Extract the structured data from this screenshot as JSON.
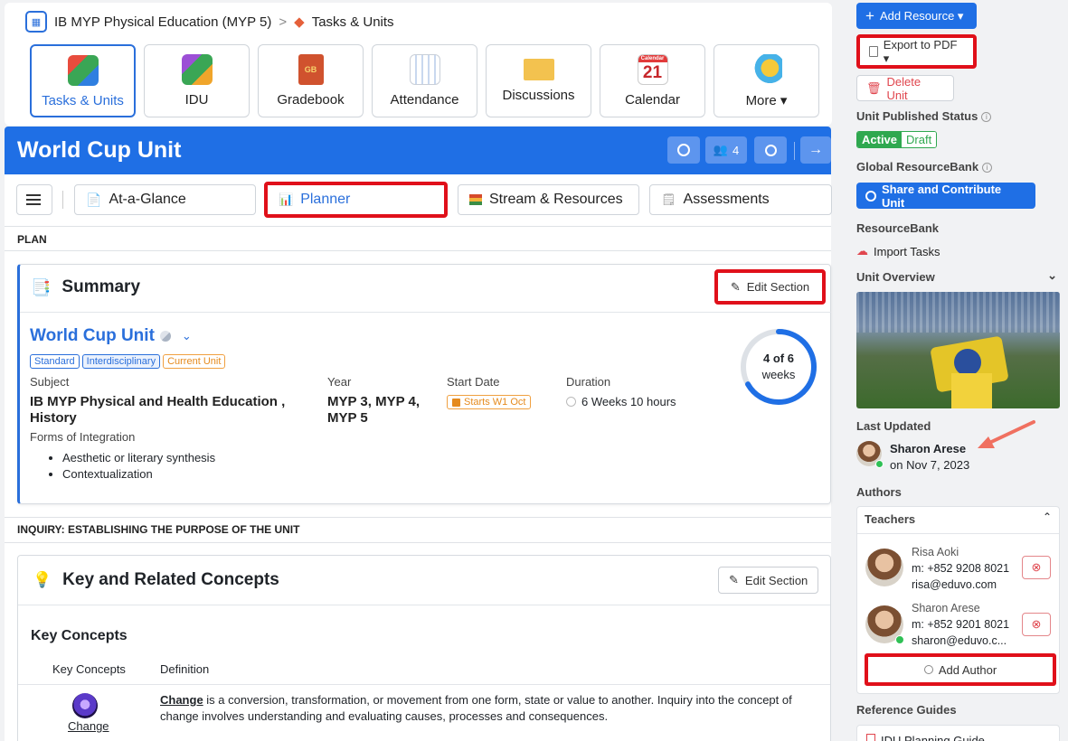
{
  "breadcrumb": {
    "course": "IB MYP Physical Education (MYP 5)",
    "separator": ">",
    "page": "Tasks & Units"
  },
  "nav_tiles": [
    "Tasks & Units",
    "IDU",
    "Gradebook",
    "Attendance",
    "Discussions",
    "Calendar",
    "More ▾"
  ],
  "calendar_tile": {
    "header": "Calendar",
    "day": "21"
  },
  "gradebook_tile": {
    "badge": "GB"
  },
  "unit_header": {
    "title": "World Cup Unit",
    "members_count": "4"
  },
  "tabs": {
    "at_a_glance": "At-a-Glance",
    "planner": "Planner",
    "stream": "Stream & Resources",
    "assessments": "Assessments"
  },
  "plan_label": "PLAN",
  "summary": {
    "heading": "Summary",
    "edit": "Edit Section",
    "unit_name": "World Cup Unit",
    "tags": [
      "Standard",
      "Interdisciplinary",
      "Current Unit"
    ],
    "subject_label": "Subject",
    "subject_value": "IB MYP Physical and Health Education , History",
    "year_label": "Year",
    "year_value": "MYP 3, MYP 4, MYP 5",
    "start_label": "Start Date",
    "start_value": "Starts W1 Oct",
    "duration_label": "Duration",
    "duration_value": "6 Weeks 10 hours",
    "forms_label": "Forms of Integration",
    "forms": [
      "Aesthetic or literary synthesis",
      "Contextualization"
    ],
    "progress_line1": "4 of 6",
    "progress_line2": "weeks",
    "progress_fraction": 0.667
  },
  "inquiry_label": "INQUIRY: ESTABLISHING THE PURPOSE OF THE UNIT",
  "concepts": {
    "heading": "Key and Related Concepts",
    "edit": "Edit Section",
    "subheading": "Key Concepts",
    "col1": "Key Concepts",
    "col2": "Definition",
    "concept_name": "Change",
    "definition_term": "Change",
    "definition_text": " is a conversion, transformation, or movement from one form, state or value to another. Inquiry into the concept of change involves understanding and evaluating causes, processes and consequences."
  },
  "sidebar": {
    "add_resource": "Add Resource ▾",
    "export_pdf": "Export to PDF ▾",
    "delete_unit": "Delete Unit",
    "published_label": "Unit Published Status",
    "status_active": "Active",
    "status_draft": "Draft",
    "global_label": "Global ResourceBank",
    "share": "Share and Contribute Unit",
    "resourcebank_label": "ResourceBank",
    "import_tasks": "Import Tasks",
    "overview_label": "Unit Overview",
    "last_updated_label": "Last Updated",
    "last_updated_name": "Sharon Arese",
    "last_updated_date": "on Nov 7, 2023",
    "authors_label": "Authors",
    "teachers_label": "Teachers",
    "teachers": [
      {
        "name": "Risa Aoki",
        "phone": "m: +852 9208 8021",
        "email": "risa@eduvo.com"
      },
      {
        "name": "Sharon Arese",
        "phone": "m: +852 9201 8021",
        "email": "sharon@eduvo.c..."
      }
    ],
    "add_author": "Add Author",
    "reference_label": "Reference Guides",
    "reference_item": "IDU Planning Guide"
  },
  "colors": {
    "accent": "#1f6fe5",
    "highlight": "#e0101a",
    "active_green": "#2fa84f",
    "annotation_arrow": "#f07060"
  }
}
